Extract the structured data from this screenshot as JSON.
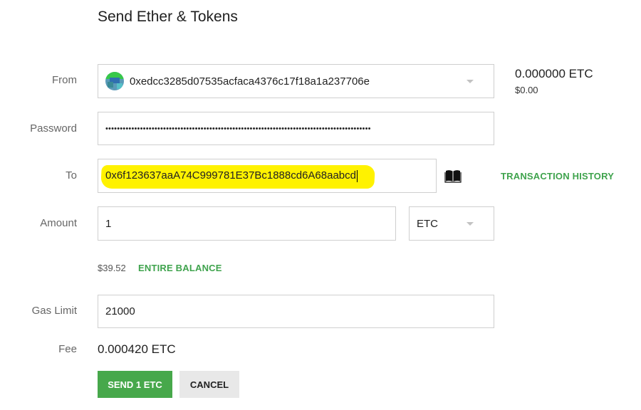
{
  "page": {
    "title": "Send Ether & Tokens"
  },
  "labels": {
    "from": "From",
    "password": "Password",
    "to": "To",
    "amount": "Amount",
    "gas_limit": "Gas Limit",
    "fee": "Fee"
  },
  "from": {
    "address": "0xedcc3285d07535acfaca4376c17f18a1a237706e"
  },
  "balance": {
    "amount": "0.000000 ETC",
    "usd": "$0.00"
  },
  "password": {
    "masked_value": "••••••••••••••••••••••••••••••••••••••••••••••••••••••••••••••••••••••••••••••••••••••••••••"
  },
  "to": {
    "address": "0x6f123637aaA74C999781E37Bc1888cd6A68aabcd"
  },
  "links": {
    "transaction_history": "TRANSACTION HISTORY",
    "entire_balance": "ENTIRE BALANCE"
  },
  "amount": {
    "value": "1",
    "usd": "$39.52",
    "currency": "ETC"
  },
  "gas_limit": {
    "value": "21000"
  },
  "fee": {
    "value": "0.000420 ETC"
  },
  "buttons": {
    "send": "SEND 1 ETC",
    "cancel": "CANCEL"
  },
  "colors": {
    "accent_green": "#47a84b",
    "highlight_yellow": "#fff200"
  },
  "icons": {
    "address_book": "book-icon",
    "dropdown": "chevron-down-icon"
  }
}
